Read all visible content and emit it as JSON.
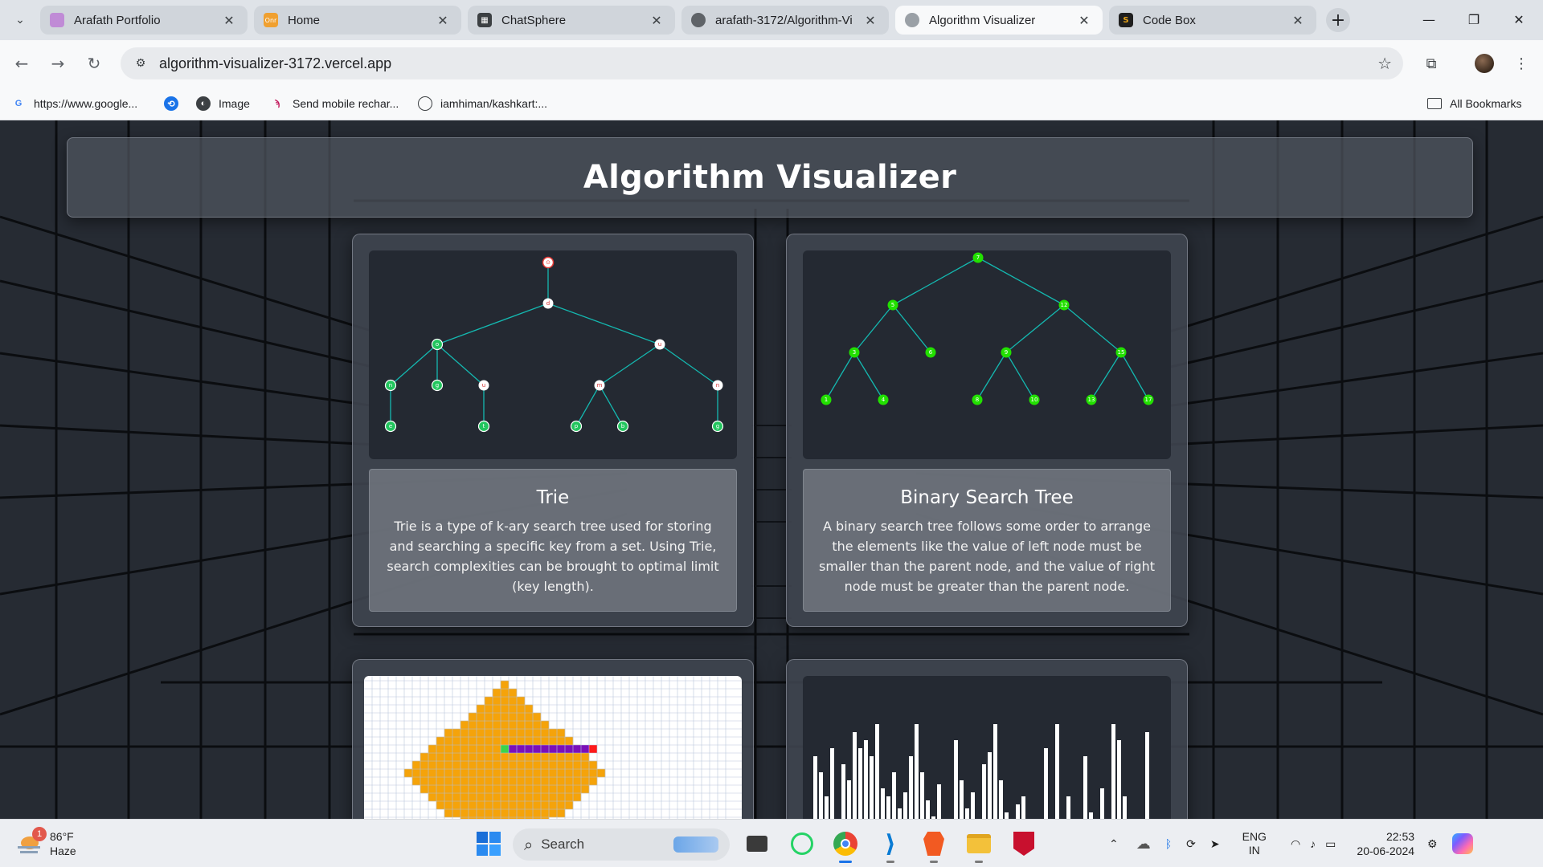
{
  "tabs": [
    {
      "title": "Arafath Portfolio",
      "icon": "portfolio-favicon",
      "color": "#c08bd6"
    },
    {
      "title": "Home",
      "icon": "onr-favicon",
      "color": "#f0a030"
    },
    {
      "title": "ChatSphere",
      "icon": "chatsphere-favicon",
      "color": "#3c4043"
    },
    {
      "title": "arafath-3172/Algorithm-Vi",
      "icon": "github-icon",
      "color": "#5f6368"
    },
    {
      "title": "Algorithm Visualizer",
      "icon": "globe-icon",
      "color": "#9aa0a6"
    },
    {
      "title": "Code Box",
      "icon": "codebox-favicon",
      "color": "#e8a317"
    }
  ],
  "address_bar": {
    "url": "algorithm-visualizer-3172.vercel.app"
  },
  "bookmarks": {
    "items": [
      "https://www.google...",
      "",
      "Image",
      "Send mobile rechar...",
      "iamhiman/kashkart:..."
    ],
    "all_bookmarks": "All Bookmarks"
  },
  "page": {
    "title": "Algorithm Visualizer",
    "cards": [
      {
        "title": "Trie",
        "description": "Trie is a type of k-ary search tree used for storing and searching a specific key from a set. Using Trie, search complexities can be brought to optimal limit (key length)."
      },
      {
        "title": "Binary Search Tree",
        "description": "A binary search tree follows some order to arrange the elements like the value of left node must be smaller than the parent node, and the value of right node must be greater than the parent node."
      }
    ]
  },
  "trie": {
    "root": "⊙",
    "level1": "d",
    "level2": [
      "o",
      "u"
    ],
    "level3": [
      "n",
      "g",
      "u",
      "m",
      "n"
    ],
    "level4": [
      "e",
      "t",
      "p",
      "b",
      "g"
    ]
  },
  "bst": {
    "nodes": [
      "7",
      "5",
      "12",
      "3",
      "6",
      "9",
      "15",
      "1",
      "4",
      "8",
      "10",
      "13",
      "17"
    ]
  },
  "taskbar": {
    "weather_temp": "86°F",
    "weather_desc": "Haze",
    "weather_badge": "1",
    "search_label": "Search",
    "lang_top": "ENG",
    "lang_bottom": "IN",
    "time": "22:53",
    "date": "20-06-2024"
  },
  "colors": {
    "tree_edge": "#14b8b0",
    "node_green": "#22c55e",
    "bst_node": "#22e000",
    "grid_path": "#f5a30a",
    "path_line": "#7b10b8",
    "bar_color": "#ffffff"
  }
}
